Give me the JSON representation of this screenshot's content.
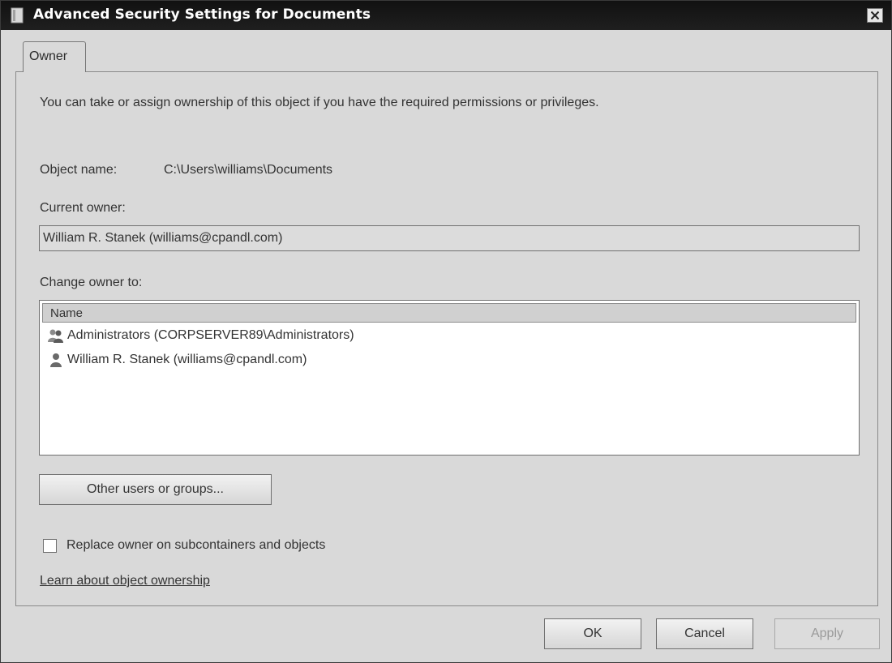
{
  "window": {
    "title": "Advanced Security Settings for Documents",
    "close_symbol": "✕"
  },
  "tabs": [
    {
      "label": "Owner"
    }
  ],
  "owner_tab": {
    "description": "You can take or assign ownership of this object if you have the required permissions or privileges.",
    "object_name_label": "Object name:",
    "object_name_value": "C:\\Users\\williams\\Documents",
    "current_owner_label": "Current owner:",
    "current_owner_value": "William R. Stanek (williams@cpandl.com)",
    "change_owner_label": "Change owner to:",
    "list_header": "Name",
    "list_items": [
      {
        "label": "Administrators (CORPSERVER89\\Administrators)",
        "icon": "group-icon"
      },
      {
        "label": "William R. Stanek (williams@cpandl.com)",
        "icon": "user-icon"
      }
    ],
    "other_users_button": "Other users or groups...",
    "replace_owner_checkbox": "Replace owner on subcontainers and objects",
    "replace_owner_checked": false,
    "learn_link": "Learn about object ownership"
  },
  "footer": {
    "ok": "OK",
    "cancel": "Cancel",
    "apply": "Apply"
  },
  "colors": {
    "titlebar": "#111111",
    "dialog_bg": "#d9d9d9",
    "disabled_text": "#9a9a9a"
  }
}
